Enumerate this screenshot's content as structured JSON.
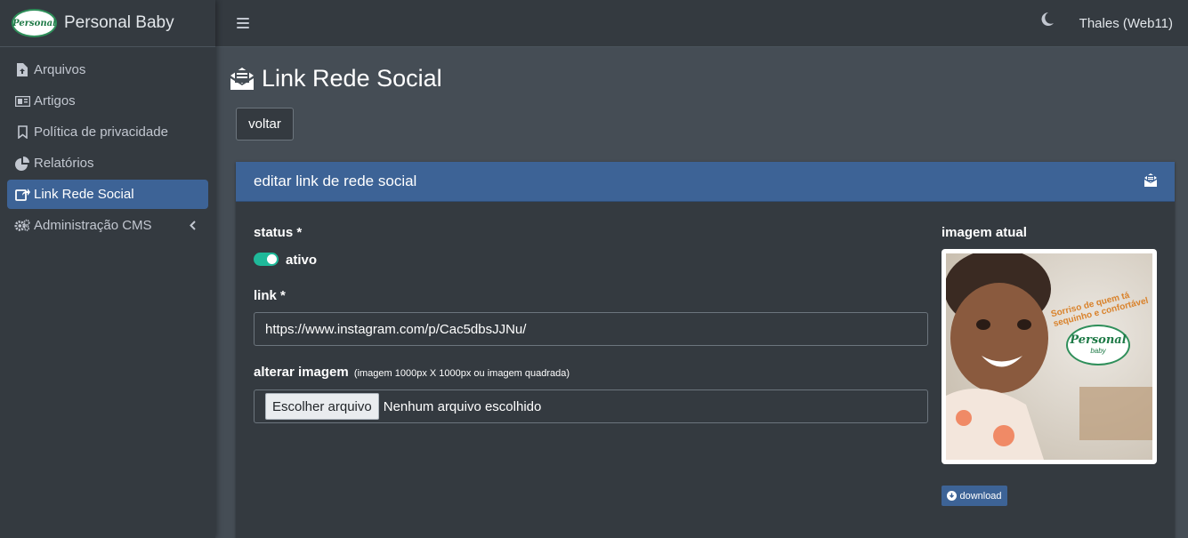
{
  "brand": {
    "name": "Personal Baby",
    "logo_text": "Personal"
  },
  "sidebar": {
    "items": [
      {
        "label": "Arquivos",
        "icon": "file-upload-icon"
      },
      {
        "label": "Artigos",
        "icon": "newspaper-icon"
      },
      {
        "label": "Política de privacidade",
        "icon": "bookmark-icon"
      },
      {
        "label": "Relatórios",
        "icon": "pie-chart-icon"
      },
      {
        "label": "Link Rede Social",
        "icon": "share-square-icon",
        "active": true
      },
      {
        "label": "Administração CMS",
        "icon": "cogs-icon"
      }
    ]
  },
  "topbar": {
    "user": "Thales (Web11)"
  },
  "page": {
    "title": "Link Rede Social",
    "back_label": "voltar"
  },
  "card": {
    "header": "editar link de rede social",
    "status_label": "status *",
    "status_value": "ativo",
    "link_label": "link *",
    "link_value": "https://www.instagram.com/p/Cac5dbsJJNu/",
    "image_label": "alterar imagem",
    "image_hint": "(imagem 1000px X 1000px ou imagem quadrada)",
    "file_button": "Escolher arquivo",
    "file_status": "Nenhum arquivo escolhido",
    "current_image_label": "imagem atual",
    "image_text": "Sorriso de quem tá sequinho e confortável",
    "image_logo": "Personal",
    "image_logo_sub": "baby",
    "download_label": "download"
  },
  "colors": {
    "sidebar_bg": "#343a40",
    "content_bg": "#454d55",
    "accent": "#3d6396",
    "toggle_on": "#1fb99a"
  }
}
